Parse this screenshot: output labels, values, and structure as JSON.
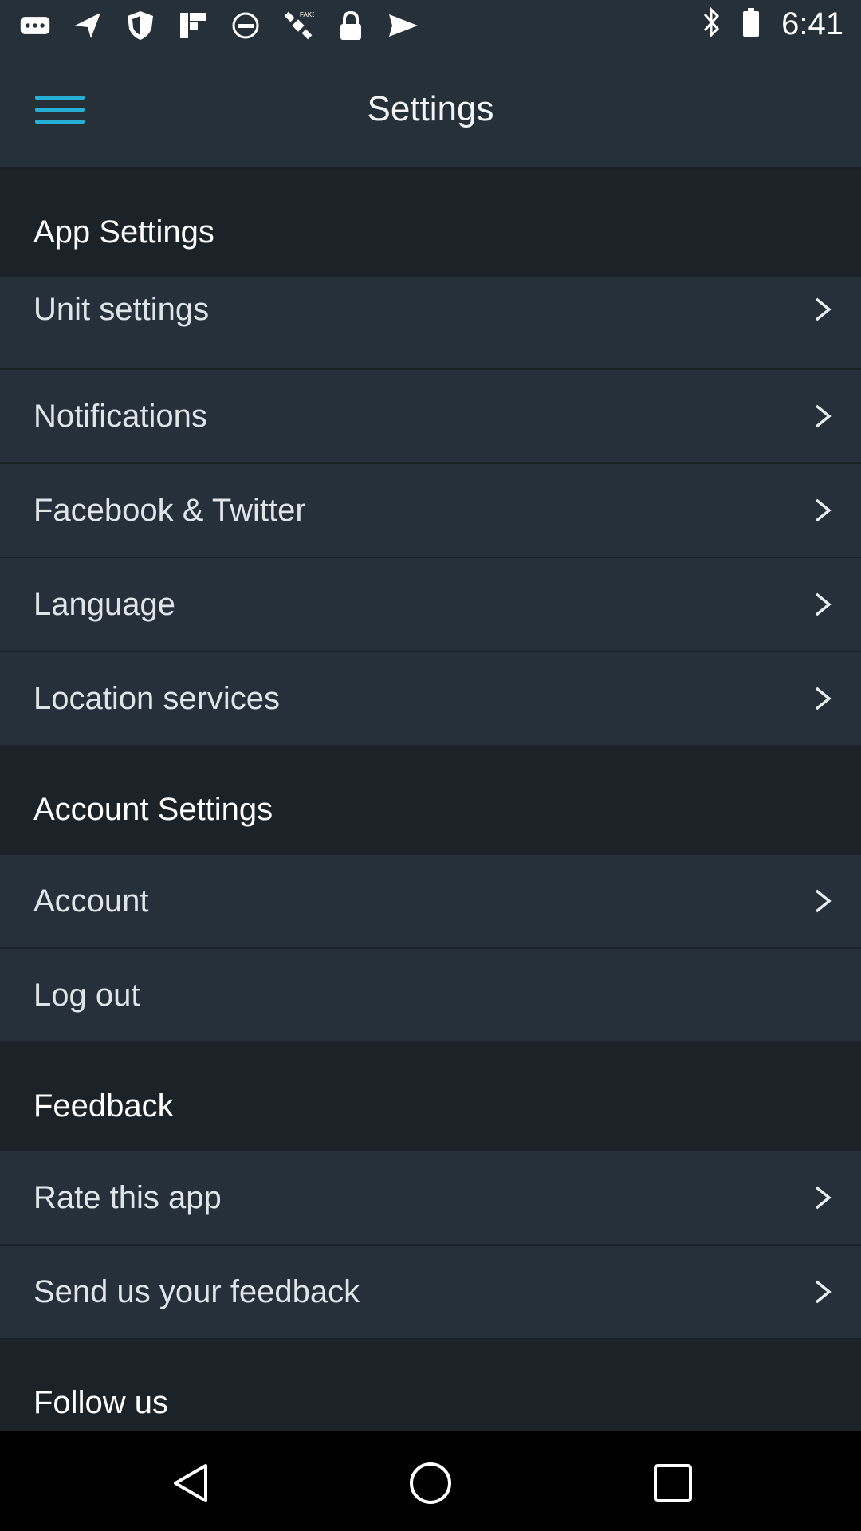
{
  "status_bar": {
    "time": "6:41",
    "icons": [
      "messages-icon",
      "location-arrow-icon",
      "shield-icon",
      "flipboard-icon",
      "no-disturb-icon",
      "satellite-fake-gps-icon",
      "lock-icon",
      "send-icon",
      "bluetooth-icon",
      "battery-icon"
    ]
  },
  "app_bar": {
    "title": "Settings",
    "menu_icon": "hamburger-menu-icon",
    "accent_color": "#27b0d6"
  },
  "sections": [
    {
      "header": "App Settings",
      "items": [
        {
          "label": "Unit settings",
          "chevron": true
        },
        {
          "label": "Notifications",
          "chevron": true
        },
        {
          "label": "Facebook & Twitter",
          "chevron": true
        },
        {
          "label": "Language",
          "chevron": true
        },
        {
          "label": "Location services",
          "chevron": true
        }
      ]
    },
    {
      "header": "Account Settings",
      "items": [
        {
          "label": "Account",
          "chevron": true
        },
        {
          "label": "Log out",
          "chevron": false
        }
      ]
    },
    {
      "header": "Feedback",
      "items": [
        {
          "label": "Rate this app",
          "chevron": true
        },
        {
          "label": "Send us your feedback",
          "chevron": true
        }
      ]
    },
    {
      "header": "Follow us",
      "items": []
    }
  ],
  "nav_bar": {
    "back": "back-triangle-icon",
    "home": "home-circle-icon",
    "recents": "recents-square-icon"
  }
}
